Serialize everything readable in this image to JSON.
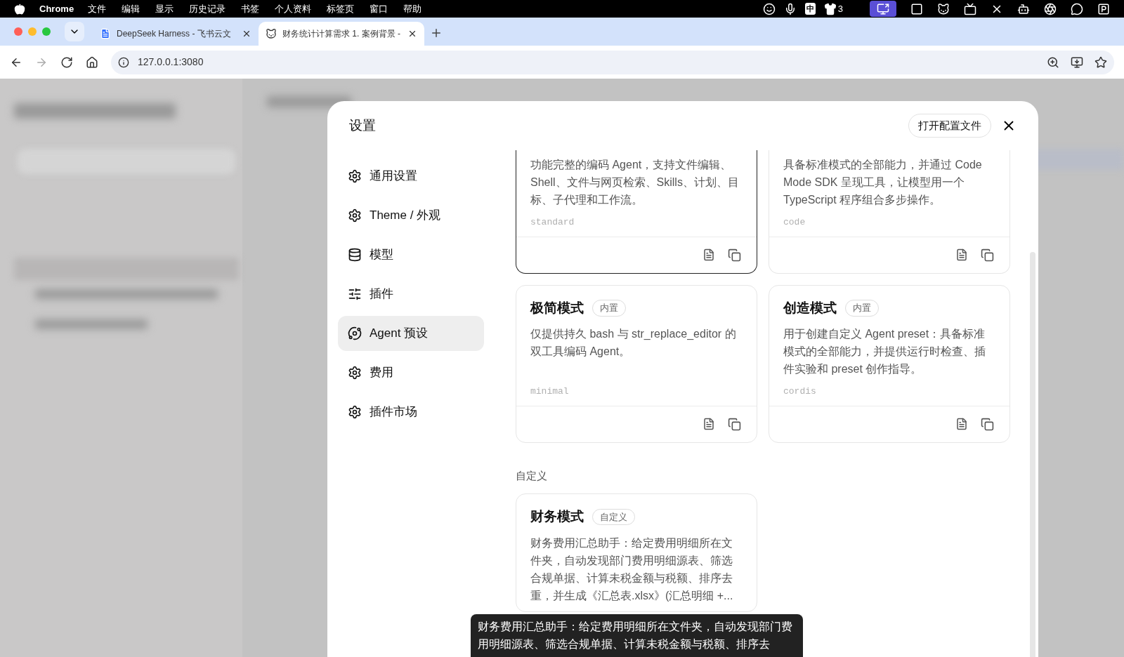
{
  "menubar": {
    "app": "Chrome",
    "menus": [
      "文件",
      "编辑",
      "显示",
      "历史记录",
      "书签",
      "个人资料",
      "标签页",
      "窗口",
      "帮助"
    ],
    "ime": "中",
    "badge_count": "3"
  },
  "browser": {
    "tabs": [
      {
        "title": "DeepSeek Harness - 飞书云文",
        "selected": false
      },
      {
        "title": "财务统计计算需求 1. 案例背景 -",
        "selected": true
      }
    ],
    "url": "127.0.0.1:3080"
  },
  "settings": {
    "title": "设置",
    "open_config_button": "打开配置文件",
    "nav": [
      {
        "label": "通用设置",
        "selected": false
      },
      {
        "label": "Theme / 外观",
        "selected": false
      },
      {
        "label": "模型",
        "selected": false
      },
      {
        "label": "插件",
        "selected": false
      },
      {
        "label": "Agent 预设",
        "selected": true
      },
      {
        "label": "费用",
        "selected": false
      },
      {
        "label": "插件市场",
        "selected": false
      }
    ],
    "sections": [
      {
        "presets": [
          {
            "description": "功能完整的编码 Agent，支持文件编辑、Shell、文件与网页检索、Skills、计划、目标、子代理和工作流。",
            "slug": "standard",
            "selected": true
          },
          {
            "description": "具备标准模式的全部能力，并通过 Code Mode SDK 呈现工具，让模型用一个 TypeScript 程序组合多步操作。",
            "slug": "code",
            "selected": false
          },
          {
            "title": "极简模式",
            "tag": "内置",
            "description": "仅提供持久 bash 与 str_replace_editor 的双工具编码 Agent。",
            "slug": "minimal",
            "selected": false
          },
          {
            "title": "创造模式",
            "tag": "内置",
            "description": "用于创建自定义 Agent preset：具备标准模式的全部能力，并提供运行时检查、插件实验和 preset 创作指导。",
            "slug": "cordis",
            "selected": false
          }
        ]
      },
      {
        "heading": "自定义",
        "presets": [
          {
            "title": "财务模式",
            "tag": "自定义",
            "description": "财务费用汇总助手：给定费用明细所在文件夹，自动发现部门费用明细源表、筛选合规单据、计算未税金额与税额、排序去重，并生成《汇总表.xlsx》(汇总明细 +...",
            "selected": false
          }
        ]
      }
    ]
  },
  "tooltip": {
    "text": "财务费用汇总助手：给定费用明细所在文件夹，自动发现部门费用明细源表、筛选合规单据、计算未税金额与税额、排序去"
  }
}
